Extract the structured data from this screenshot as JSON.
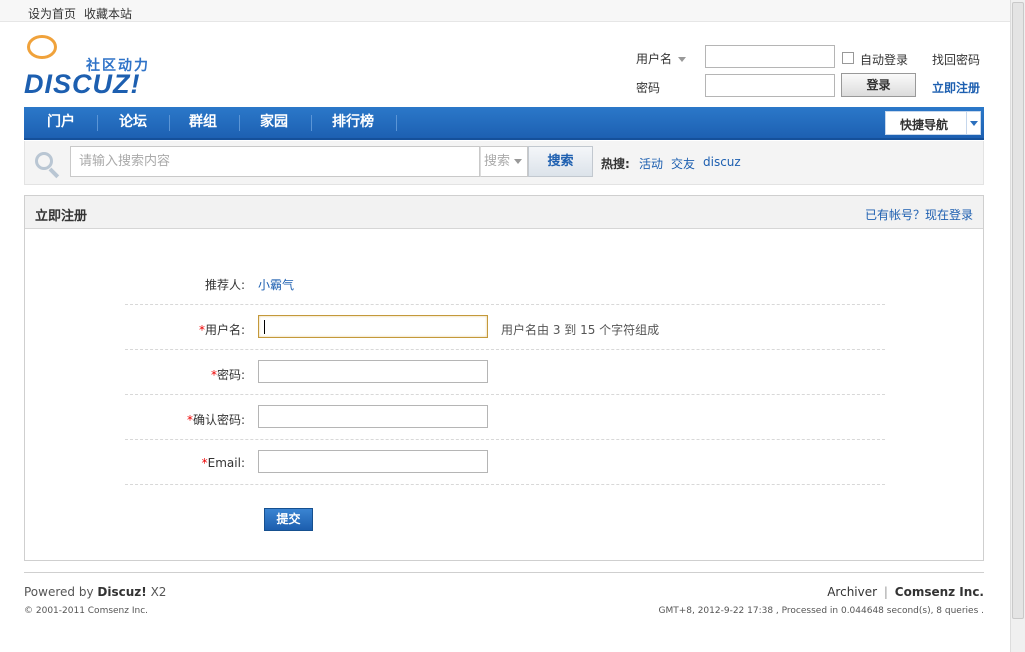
{
  "topbar": {
    "set_home": "设为首页",
    "bookmark": "收藏本站"
  },
  "logo": {
    "tagline": "社区动力",
    "text": "DISCUZ!"
  },
  "login": {
    "username_label": "用户名",
    "password_label": "密码",
    "auto_login": "自动登录",
    "login_button": "登录",
    "find_password": "找回密码",
    "register_now": "立即注册"
  },
  "nav": {
    "items": [
      "门户",
      "论坛",
      "群组",
      "家园",
      "排行榜"
    ],
    "quick_nav": "快捷导航"
  },
  "search": {
    "placeholder": "请输入搜索内容",
    "type": "搜索",
    "button": "搜索",
    "hot_label": "热搜:",
    "hot_links": [
      "活动",
      "交友",
      "discuz"
    ]
  },
  "register": {
    "title": "立即注册",
    "have_account": "已有帐号？现在登录",
    "referrer_label": "推荐人:",
    "referrer_value": "小霸气",
    "required_mark": "*",
    "username_label": "用户名:",
    "username_hint": "用户名由 3 到 15 个字符组成",
    "password_label": "密码:",
    "confirm_label": "确认密码:",
    "email_label": "Email:",
    "submit": "提交"
  },
  "footer": {
    "powered_prefix": "Powered by",
    "powered_brand": "Discuz!",
    "powered_version": "X2",
    "copyright": "© 2001-2011 Comsenz Inc.",
    "archiver": "Archiver",
    "separator": "|",
    "company": "Comsenz Inc.",
    "stats": "GMT+8, 2012-9-22 17:38 , Processed in 0.044648 second(s), 8 queries ."
  }
}
